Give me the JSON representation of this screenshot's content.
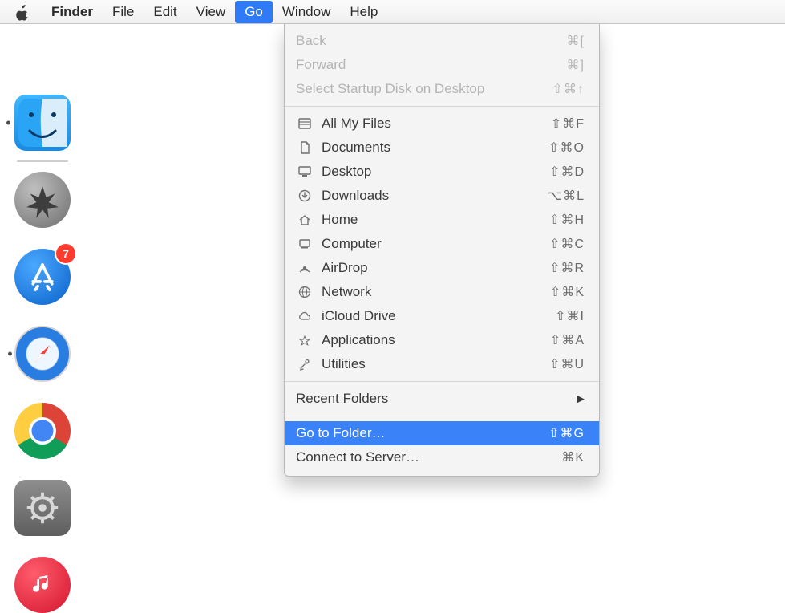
{
  "menubar": {
    "items": [
      {
        "label": "Finder",
        "bold": true
      },
      {
        "label": "File"
      },
      {
        "label": "Edit"
      },
      {
        "label": "View"
      },
      {
        "label": "Go",
        "active": true
      },
      {
        "label": "Window"
      },
      {
        "label": "Help"
      }
    ]
  },
  "go_menu": {
    "groups": [
      [
        {
          "label": "Back",
          "shortcut": "⌘[",
          "disabled": true
        },
        {
          "label": "Forward",
          "shortcut": "⌘]",
          "disabled": true
        },
        {
          "label": "Select Startup Disk on Desktop",
          "shortcut": "⇧⌘↑",
          "disabled": true
        }
      ],
      [
        {
          "icon": "all-my-files-icon",
          "label": "All My Files",
          "shortcut": "⇧⌘F"
        },
        {
          "icon": "documents-icon",
          "label": "Documents",
          "shortcut": "⇧⌘O"
        },
        {
          "icon": "desktop-icon",
          "label": "Desktop",
          "shortcut": "⇧⌘D"
        },
        {
          "icon": "downloads-icon",
          "label": "Downloads",
          "shortcut": "⌥⌘L"
        },
        {
          "icon": "home-icon",
          "label": "Home",
          "shortcut": "⇧⌘H"
        },
        {
          "icon": "computer-icon",
          "label": "Computer",
          "shortcut": "⇧⌘C"
        },
        {
          "icon": "airdrop-icon",
          "label": "AirDrop",
          "shortcut": "⇧⌘R"
        },
        {
          "icon": "network-icon",
          "label": "Network",
          "shortcut": "⇧⌘K"
        },
        {
          "icon": "icloud-icon",
          "label": "iCloud Drive",
          "shortcut": "⇧⌘I"
        },
        {
          "icon": "applications-icon",
          "label": "Applications",
          "shortcut": "⇧⌘A"
        },
        {
          "icon": "utilities-icon",
          "label": "Utilities",
          "shortcut": "⇧⌘U"
        }
      ],
      [
        {
          "label": "Recent Folders",
          "submenu": true
        }
      ],
      [
        {
          "label": "Go to Folder…",
          "shortcut": "⇧⌘G",
          "highlight": true
        },
        {
          "label": "Connect to Server…",
          "shortcut": "⌘K"
        }
      ]
    ]
  },
  "dock": {
    "items": [
      {
        "name": "finder",
        "badge": null,
        "running": true
      },
      {
        "name": "launchpad",
        "badge": null,
        "running": false,
        "sep_before": true
      },
      {
        "name": "appstore",
        "badge": "7",
        "running": false
      },
      {
        "name": "safari",
        "badge": null,
        "running": true
      },
      {
        "name": "chrome",
        "badge": null,
        "running": false
      },
      {
        "name": "sysprefs",
        "badge": null,
        "running": false
      },
      {
        "name": "itunes",
        "badge": null,
        "running": false
      }
    ]
  }
}
